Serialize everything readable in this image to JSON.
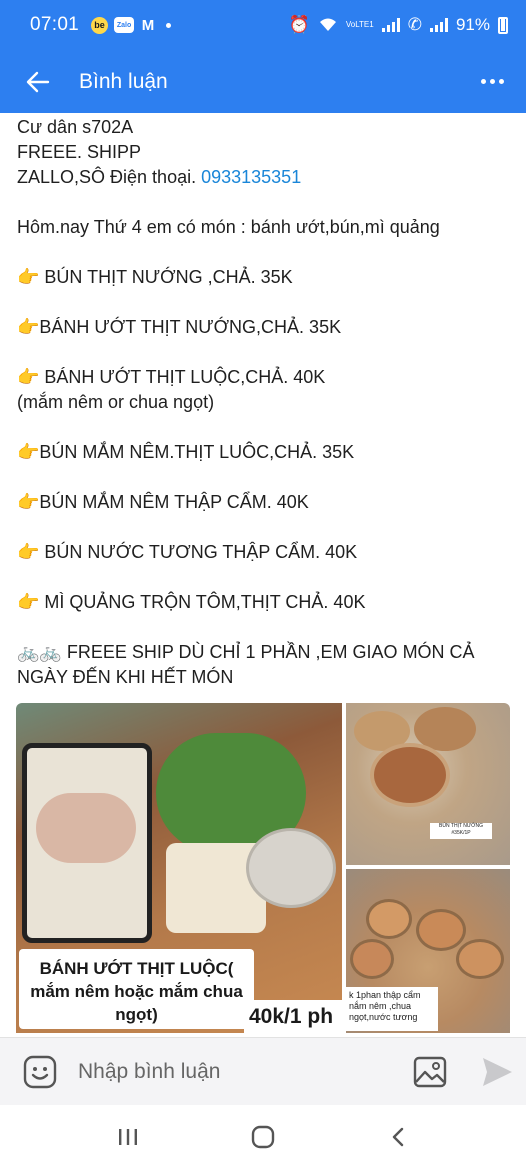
{
  "status_bar": {
    "time": "07:01",
    "apps": [
      "be",
      "Zalo",
      "M"
    ],
    "signal_label": "VoLTE1",
    "battery": "91%"
  },
  "app_bar": {
    "title": "Bình luận",
    "back_icon": "arrow-left-icon",
    "more_icon": "more-horizontal-icon"
  },
  "post": {
    "line1": "Cư dân s702A",
    "line2": "FREEE. SHIPP",
    "contact_prefix": "ZALLO,SÔ Điện thoại. ",
    "phone": "0933135351",
    "intro": "Hôm.nay Thứ 4 em có món : bánh ướt,bún,mì quảng",
    "menu": [
      {
        "icon": "👉",
        "text": " BÚN THỊT NƯỚNG ,CHẢ. 35K"
      },
      {
        "icon": "👉",
        "text": "BÁNH ƯỚT THỊT NƯỚNG,CHẢ. 35K"
      },
      {
        "icon": "👉",
        "text": " BÁNH ƯỚT THỊT LUỘC,CHẢ. 40K",
        "sub": "(mắm nêm or chua ngọt)"
      },
      {
        "icon": "👉",
        "text": "BÚN MẮM NÊM.THỊT LUÔC,CHẢ. 35K"
      },
      {
        "icon": "👉",
        "text": "BÚN MẮM NÊM THẬP CẨM. 40K"
      },
      {
        "icon": "👉",
        "text": " BÚN NƯỚC TƯƠNG THẬP CẨM. 40K"
      },
      {
        "icon": "👉",
        "text": " MÌ QUẢNG TRỘN TÔM,THỊT CHẢ. 40K"
      }
    ],
    "footer_icons": "🚲🚲",
    "footer": " FREEE SHIP DÙ CHỈ 1 PHẦN ,EM GIAO MÓN CẢ NGÀY ĐẾN KHI HẾT MÓN"
  },
  "photos": {
    "main_caption": "BÁNH ƯỚT THỊT LUỘC( mắm nêm hoặc mắm chua ngọt)",
    "main_price": "40k/1 ph",
    "top_right_label": "BÚN THỊT NƯỚNG #35K/1P",
    "bottom_right_label": "k 1phan thập cẩm nắm nêm ,chua ngọt,nước tương"
  },
  "comment_input": {
    "placeholder": "Nhập bình luận",
    "emoji_icon": "emoji-icon",
    "image_icon": "image-icon",
    "send_icon": "send-icon"
  },
  "nav": {
    "recent_icon": "recents-icon",
    "home_icon": "home-icon",
    "back_icon": "back-icon"
  },
  "colors": {
    "accent": "#2d7ff0",
    "link": "#1a86d8"
  }
}
